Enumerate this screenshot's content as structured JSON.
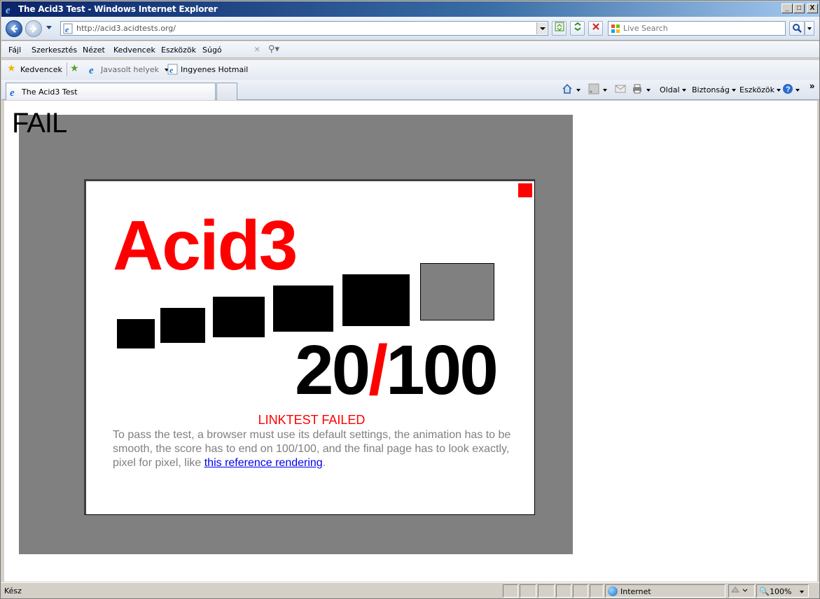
{
  "window": {
    "title": "The Acid3 Test - Windows Internet Explorer",
    "minimize": "_",
    "maximize": "□",
    "close": "X"
  },
  "address_bar": {
    "url": "http://acid3.acidtests.org/",
    "search_placeholder": "Live Search"
  },
  "menu": {
    "items": [
      "Fájl",
      "Szerkesztés",
      "Nézet",
      "Kedvencek",
      "Eszközök",
      "Súgó"
    ]
  },
  "favorites_bar": {
    "favorites_label": "Kedvencek",
    "suggested_sites": "Javasolt helyek",
    "hotmail": "Ingyenes Hotmail"
  },
  "tabs": {
    "active_tab": "The Acid3 Test"
  },
  "command_bar": {
    "page": "Oldal",
    "safety": "Biztonság",
    "tools": "Eszközök"
  },
  "page": {
    "fail_label": "FAIL",
    "acid_title": "Acid3",
    "score_value": "20",
    "score_slash": "/",
    "score_total": "100",
    "status_message": "LINKTEST FAILED",
    "info_text": "To pass the test, a browser must use its default settings, the animation has to be smooth, the score has to end on 100/100, and the final page has to look exactly, pixel for pixel, like ",
    "reference_link": "this reference rendering",
    "info_end": "."
  },
  "status_bar": {
    "text": "Kész",
    "zone": "Internet",
    "zoom": "100%"
  },
  "colors": {
    "acid_red": "#ff0000",
    "panel_gray": "#808080"
  }
}
